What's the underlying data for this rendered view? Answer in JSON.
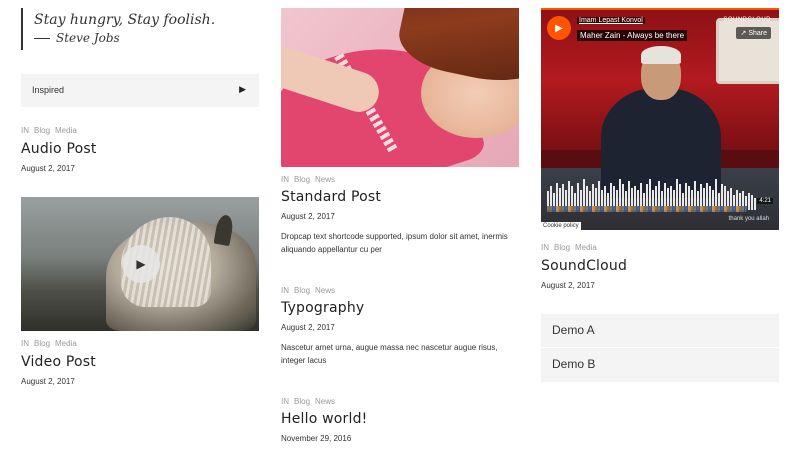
{
  "quote": {
    "text": "Stay hungry, Stay foolish.",
    "author": "Steve Jobs"
  },
  "audio_post": {
    "player_label": "Inspired",
    "meta": [
      "IN",
      "Blog",
      "Media"
    ],
    "title": "Audio Post",
    "date": "August 2, 2017"
  },
  "video_post": {
    "meta": [
      "IN",
      "Blog",
      "Media"
    ],
    "title": "Video Post",
    "date": "August 2, 2017"
  },
  "standard_post": {
    "meta": [
      "IN",
      "Blog",
      "News"
    ],
    "title": "Standard Post",
    "date": "August 2, 2017",
    "excerpt": "Dropcap text shortcode supported, ipsum dolor sit amet, inermis aliquando appellantur cu per"
  },
  "typography_post": {
    "meta": [
      "IN",
      "Blog",
      "News"
    ],
    "title": "Typography",
    "date": "August 2, 2017",
    "excerpt": "Nascetur amet urna, augue massa nec nascetur augue risus, integer lacus"
  },
  "hello_post": {
    "meta": [
      "IN",
      "Blog",
      "News"
    ],
    "title": "Hello world!",
    "date": "November 29, 2016"
  },
  "soundcloud_post": {
    "embed": {
      "artist": "Imam Lepast Konvol",
      "track": "Maher Zain - Always be there",
      "brand": "SOUNDCLOUD",
      "share": "Share",
      "duration": "4:21",
      "cookie": "Cookie policy",
      "caption": "thank you allah",
      "waveform": [
        0.55,
        0.7,
        0.5,
        0.8,
        0.65,
        0.75,
        0.6,
        0.85,
        0.7,
        0.5,
        0.8,
        0.6,
        0.9,
        0.7,
        0.55,
        0.75,
        0.65,
        0.85,
        0.6,
        0.7,
        0.5,
        0.8,
        0.7,
        0.6,
        0.9,
        0.75,
        0.55,
        0.85,
        0.65,
        0.7,
        0.6,
        0.8,
        0.5,
        0.75,
        0.9,
        0.6,
        0.7,
        0.85,
        0.55,
        0.8,
        0.65,
        0.7,
        0.6,
        0.9,
        0.75,
        0.5,
        0.8,
        0.7,
        0.6,
        0.85,
        0.55,
        0.75,
        0.65,
        0.8,
        0.7,
        0.6,
        0.9,
        0.5,
        0.75,
        0.7,
        0.55,
        0.65,
        0.45,
        0.6,
        0.5,
        0.55,
        0.4,
        0.5,
        0.45,
        0.35
      ]
    },
    "meta": [
      "IN",
      "Blog",
      "Media"
    ],
    "title": "SoundCloud",
    "date": "August 2, 2017"
  },
  "demos": [
    "Demo A",
    "Demo B"
  ]
}
